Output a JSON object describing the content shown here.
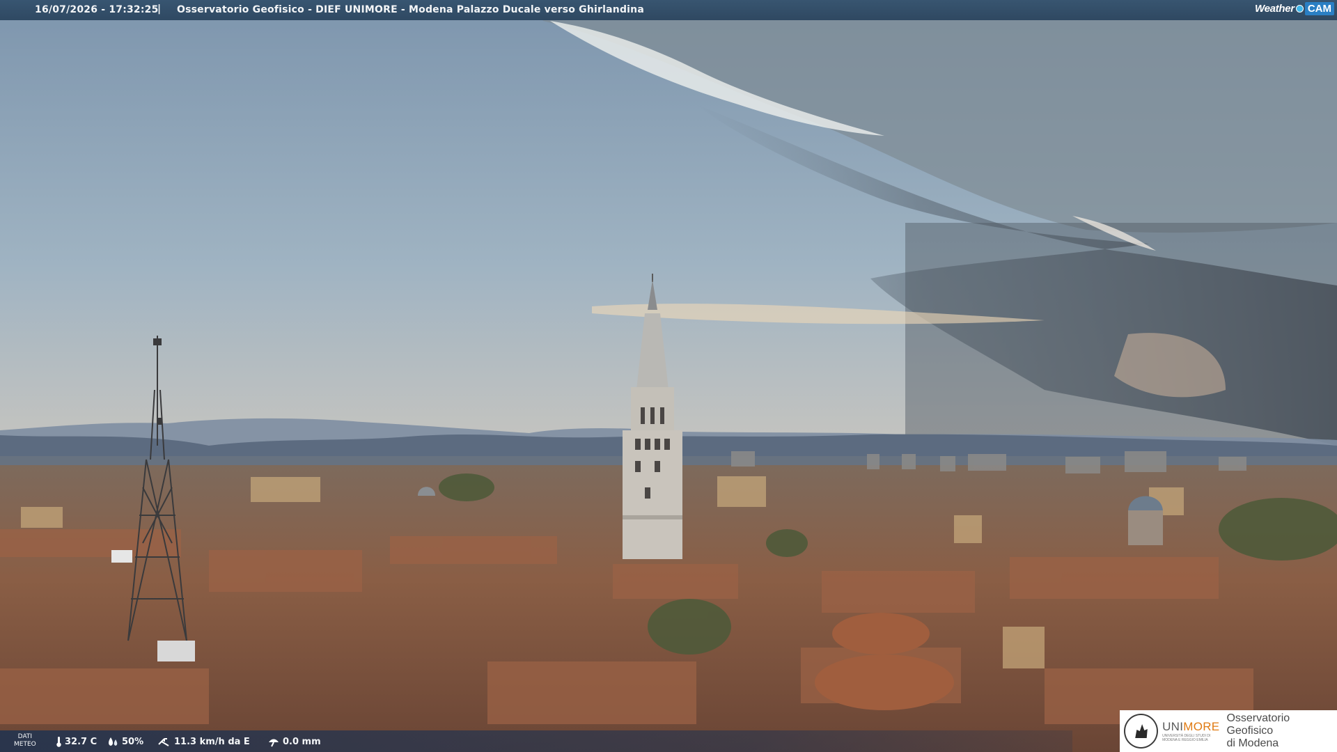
{
  "header": {
    "timestamp": "16/07/2026 - 17:32:25",
    "separator": "|",
    "title": "Osservatorio Geofisico - DIEF UNIMORE - Modena Palazzo Ducale verso Ghirlandina"
  },
  "brand": {
    "weather": "Weather",
    "cam": "CAM",
    "accent": "#2a7fc4"
  },
  "weather_data": {
    "label_line1": "DATI",
    "label_line2": "METEO",
    "temperature": "32.7 C",
    "humidity": "50%",
    "wind": "11.3 km/h da E",
    "rain": "0.0 mm",
    "icons": [
      "thermometer-icon",
      "humidity-drops-icon",
      "wind-icon",
      "rain-gauge-icon"
    ]
  },
  "logo": {
    "uni_prefix": "UNI",
    "uni_suffix": "MORE",
    "sub_line1": "UNIVERSITÀ DEGLI STUDI DI",
    "sub_line2": "MODENA E REGGIO EMILIA",
    "observatory_line1": "Osservatorio Geofisico",
    "observatory_line2": "di Modena",
    "accent": "#e07a12"
  }
}
